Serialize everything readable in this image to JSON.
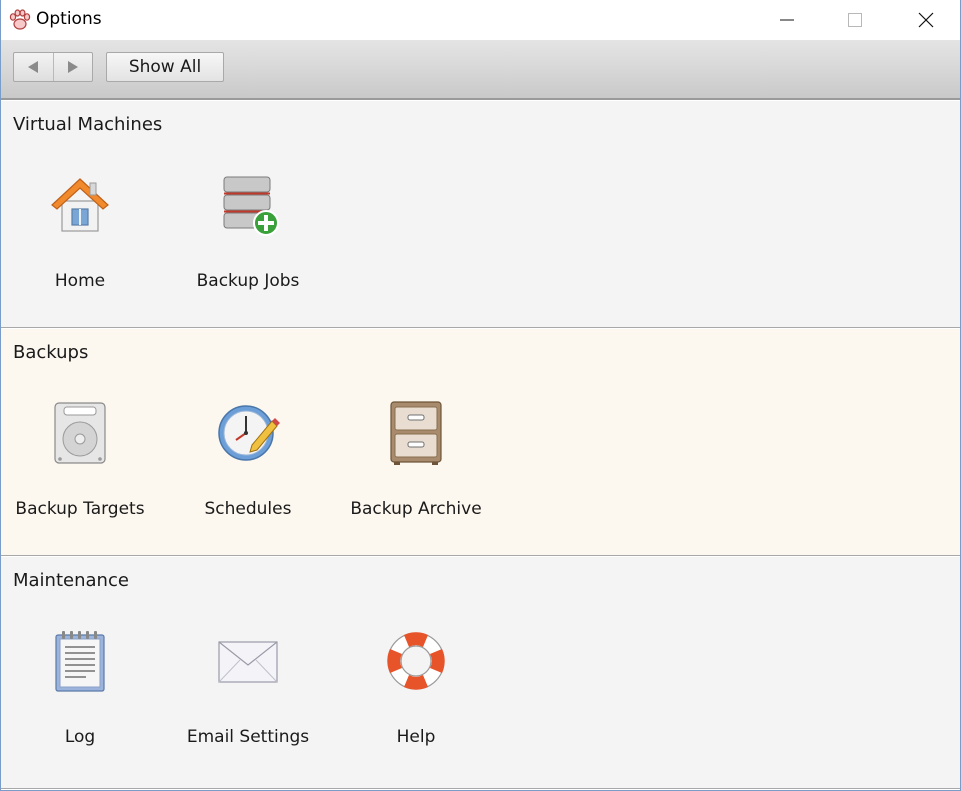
{
  "window": {
    "title": "Options",
    "app_icon": "paw-icon",
    "controls": [
      "minimize-icon",
      "maximize-icon",
      "close-icon"
    ]
  },
  "toolbar": {
    "back_icon": "back-arrow-icon",
    "forward_icon": "forward-arrow-icon",
    "show_all_label": "Show All"
  },
  "sections": [
    {
      "title": "Virtual Machines",
      "items": [
        {
          "label": "Home",
          "icon": "house-icon"
        },
        {
          "label": "Backup Jobs",
          "icon": "database-add-icon"
        }
      ]
    },
    {
      "title": "Backups",
      "items": [
        {
          "label": "Backup Targets",
          "icon": "hard-drive-icon"
        },
        {
          "label": "Schedules",
          "icon": "clock-pencil-icon"
        },
        {
          "label": "Backup Archive",
          "icon": "filing-cabinet-icon"
        }
      ]
    },
    {
      "title": "Maintenance",
      "items": [
        {
          "label": "Log",
          "icon": "notepad-icon"
        },
        {
          "label": "Email Settings",
          "icon": "envelope-icon"
        },
        {
          "label": "Help",
          "icon": "lifebuoy-icon"
        }
      ]
    }
  ],
  "colors": {
    "vm_background": "#f4f4f4",
    "backups_background": "#fdf8ef",
    "maintenance_background": "#f4f4f4"
  }
}
